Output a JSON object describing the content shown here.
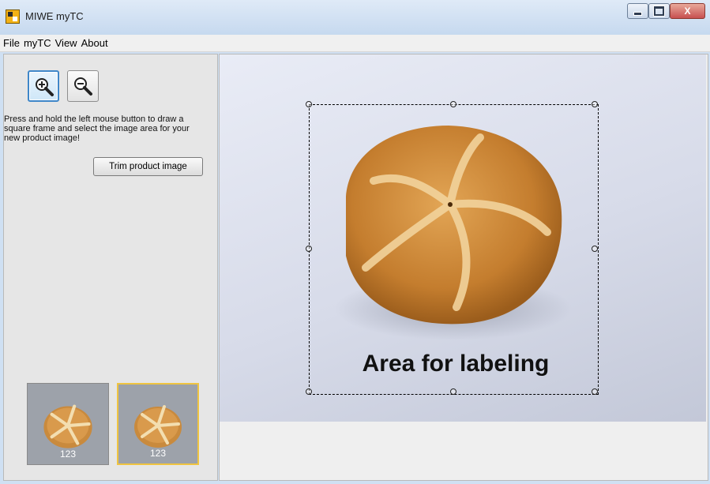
{
  "window": {
    "title": "MIWE myTC",
    "controls": {
      "minimize": "minimize",
      "maximize": "maximize",
      "close": "X"
    }
  },
  "menu": [
    "File",
    "myTC",
    "View",
    "About"
  ],
  "tools": {
    "zoom_in_icon": "zoom-in-icon",
    "zoom_out_icon": "zoom-out-icon"
  },
  "instructions": "Press and hold the left mouse button to draw a square frame and select the image area for your new product image!",
  "trim_button_label": "Trim product image",
  "thumbnails": [
    {
      "label": "123",
      "selected": false
    },
    {
      "label": "123",
      "selected": true
    }
  ],
  "canvas": {
    "overlay_text": "Area for labeling"
  },
  "colors": {
    "accent_active_tool": "#3f87c9",
    "selected_thumb_border": "#efc441",
    "bread": "#c98a3d"
  }
}
